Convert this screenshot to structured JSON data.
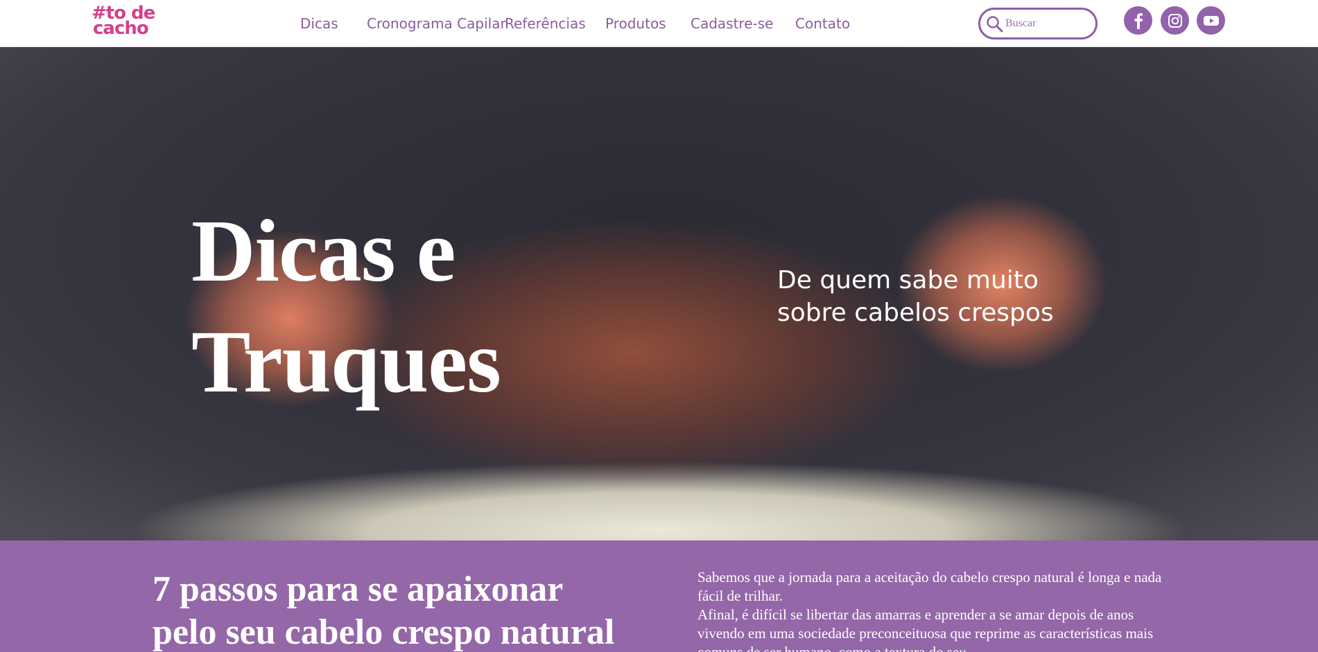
{
  "header": {
    "logo_line1": "#to de",
    "logo_line2": "cacho",
    "nav": [
      "Dicas",
      "Cronograma Capilar",
      "Referências",
      "Produtos",
      "Cadastre-se",
      "Contato"
    ],
    "search_placeholder": "Buscar",
    "social": [
      "facebook-icon",
      "instagram-icon",
      "youtube-icon"
    ]
  },
  "hero": {
    "title_line1": "Dicas e",
    "title_line2": "Truques",
    "subtitle_line1": "De quem sabe muito",
    "subtitle_line2": "sobre cabelos crespos"
  },
  "article": {
    "title_line1": "7 passos para se apaixonar",
    "title_line2": "pelo seu cabelo crespo natural",
    "p1": "Sabemos que a jornada para a aceitação do cabelo crespo natural é longa e nada fácil de trilhar.",
    "p2": "Afinal, é difícil se libertar das amarras e aprender a se amar depois de anos vivendo em uma sociedade preconceituosa que reprime as características mais comuns de ser humano, como a textura do seu"
  },
  "colors": {
    "accent": "#9262aa",
    "logo": "#d63f8c",
    "band": "#9467a8"
  }
}
